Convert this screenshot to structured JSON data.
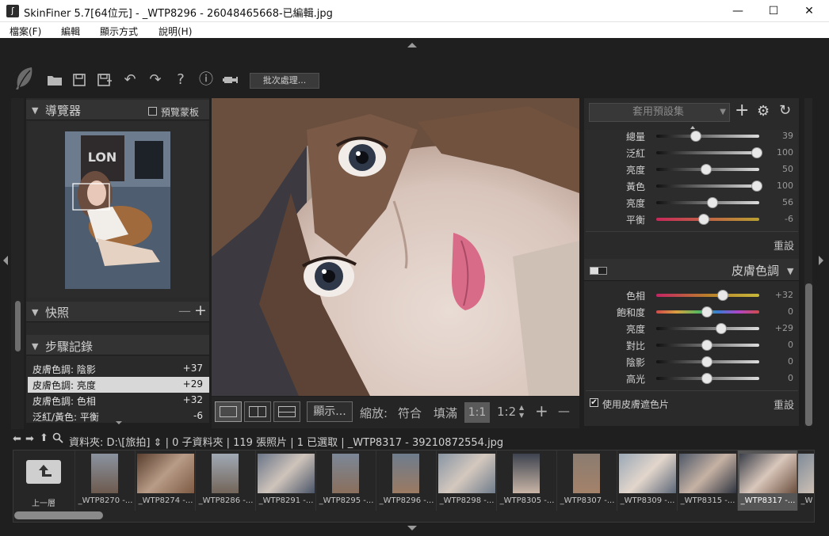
{
  "window": {
    "title": "SkinFiner 5.7[64位元] - _WTP8296 - 26048465668-已編輯.jpg",
    "minimize": "—",
    "maximize": "☐",
    "close": "✕"
  },
  "menu": [
    "檔案(F)",
    "編輯",
    "顯示方式",
    "說明(H)"
  ],
  "toolbar": {
    "batch_label": "批次處理..."
  },
  "navigator": {
    "title": "導覽器",
    "preview_mask_label": "預覽蒙板",
    "preview_mask_checked": false
  },
  "snapshots": {
    "title": "快照",
    "minus": "—",
    "plus": "+"
  },
  "history": {
    "title": "步驟記錄",
    "items": [
      {
        "label": "皮膚色調: 陰影",
        "value": "+37",
        "selected": false
      },
      {
        "label": "皮膚色調: 亮度",
        "value": "+29",
        "selected": true
      },
      {
        "label": "皮膚色調: 色相",
        "value": "+32",
        "selected": false
      },
      {
        "label": "泛紅/黃色: 平衡",
        "value": "-6",
        "selected": false
      }
    ]
  },
  "viewer_toolbar": {
    "display_label": "顯示...",
    "zoom_label": "縮放:",
    "fit_label": "符合",
    "fill_label": "填滿",
    "zoom_1_1": "1:1",
    "zoom_1_2": "1:2",
    "plus": "+",
    "minus": "—"
  },
  "presets": {
    "placeholder": "套用預設集"
  },
  "redness_sliders": [
    {
      "label": "總量",
      "value": "39",
      "fraction": 0.39
    },
    {
      "label": "泛紅",
      "value": "100",
      "fraction": 1.0
    },
    {
      "label": "亮度",
      "value": "50",
      "fraction": 0.5
    },
    {
      "label": "黃色",
      "value": "100",
      "fraction": 1.0
    },
    {
      "label": "亮度",
      "value": "56",
      "fraction": 0.56
    },
    {
      "label": "平衡",
      "value": "-6",
      "fraction": 0.47
    }
  ],
  "redness_reset": "重設",
  "skin_tone": {
    "title": "皮膚色調",
    "sliders": [
      {
        "label": "色相",
        "value": "+32",
        "fraction": 0.66
      },
      {
        "label": "飽和度",
        "value": "0",
        "fraction": 0.5
      },
      {
        "label": "亮度",
        "value": "+29",
        "fraction": 0.645
      },
      {
        "label": "對比",
        "value": "0",
        "fraction": 0.5
      },
      {
        "label": "陰影",
        "value": "0",
        "fraction": 0.5
      },
      {
        "label": "高光",
        "value": "0",
        "fraction": 0.5
      }
    ],
    "use_mask_label": "使用皮膚遮色片",
    "use_mask_checked": true,
    "reset": "重設"
  },
  "pathbar": {
    "text": "資料夾:  D:\\[旅拍] ⇕ | 0 子資料夾 | 119 張照片 | 1 已選取 | _WTP8317 - 39210872554.jpg"
  },
  "filmstrip": {
    "up_label": "上一層",
    "items": [
      "_WTP8270 -...",
      "_WTP8274 -...",
      "_WTP8286 -...",
      "_WTP8291 -...",
      "_WTP8295 -...",
      "_WTP8296 -...",
      "_WTP8298 -...",
      "_WTP8305 -...",
      "_WTP8307 -...",
      "_WTP8309 -...",
      "_WTP8315 -...",
      "_WTP8317 -...",
      "_W"
    ],
    "selected_index": 11
  }
}
